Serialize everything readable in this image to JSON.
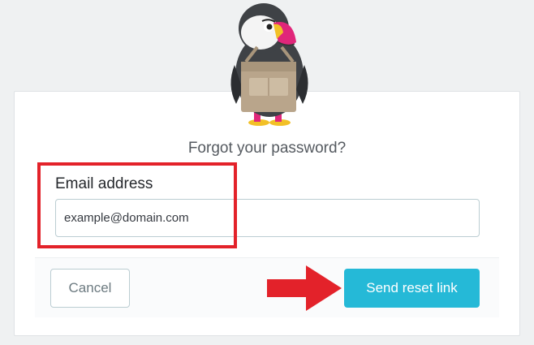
{
  "page": {
    "title": "Forgot your password?"
  },
  "form": {
    "email_label": "Email address",
    "email_placeholder": "example@domain.com",
    "email_value": ""
  },
  "actions": {
    "cancel_label": "Cancel",
    "send_label": "Send reset link"
  },
  "colors": {
    "accent": "#25b9d7",
    "annotation_red": "#e3222a",
    "background": "#eff1f2"
  },
  "icons": {
    "mascot": "prestashop-puffin-logo",
    "annotation_arrow": "arrow-right-icon"
  }
}
